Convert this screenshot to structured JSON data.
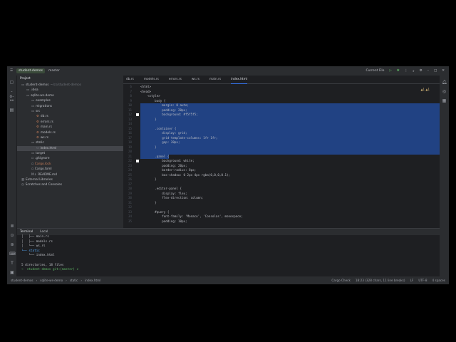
{
  "titlebar": {
    "project": "student-demos",
    "branch": "master",
    "run_config": "Current File"
  },
  "project_panel": {
    "title": "Project",
    "items": [
      {
        "label": "student-demos",
        "note": "~/cs/student-demos",
        "depth": 0,
        "icon": "folder"
      },
      {
        "label": ".idea",
        "depth": 1,
        "icon": "folder"
      },
      {
        "label": "sqlite-ws-demo",
        "depth": 1,
        "icon": "folder"
      },
      {
        "label": "examples",
        "depth": 2,
        "icon": "folder"
      },
      {
        "label": "migrations",
        "depth": 2,
        "icon": "folder"
      },
      {
        "label": "src",
        "depth": 2,
        "icon": "folder"
      },
      {
        "label": "db.rs",
        "depth": 3,
        "icon": "rust"
      },
      {
        "label": "errors.rs",
        "depth": 3,
        "icon": "rust"
      },
      {
        "label": "main.rs",
        "depth": 3,
        "icon": "rust"
      },
      {
        "label": "models.rs",
        "depth": 3,
        "icon": "rust"
      },
      {
        "label": "ws.rs",
        "depth": 3,
        "icon": "rust"
      },
      {
        "label": "static",
        "depth": 2,
        "icon": "folder"
      },
      {
        "label": "index.html",
        "depth": 3,
        "icon": "html"
      },
      {
        "label": "target",
        "depth": 2,
        "icon": "folder"
      },
      {
        "label": ".gitignore",
        "depth": 2,
        "icon": "file"
      },
      {
        "label": "Cargo.lock",
        "depth": 2,
        "icon": "file"
      },
      {
        "label": "Cargo.toml",
        "depth": 2,
        "icon": "file"
      },
      {
        "label": "README.md",
        "depth": 2,
        "icon": "md"
      },
      {
        "label": "External Libraries",
        "depth": 0,
        "icon": "lib"
      },
      {
        "label": "Scratches and Consoles",
        "depth": 0,
        "icon": "scratch"
      }
    ]
  },
  "tabs": [
    "db.rs",
    "models.rs",
    "errors.rs",
    "ws.rs",
    "main.rs",
    "index.html"
  ],
  "editor": {
    "inspection": "▲1 ▲1",
    "lines": [
      {
        "n": "6",
        "t": "<html>"
      },
      {
        "n": "7",
        "t": "<head>"
      },
      {
        "n": "8",
        "t": "    <style>"
      },
      {
        "n": "9",
        "t": "        body {"
      },
      {
        "n": "10",
        "t": "            margin: 0 auto;"
      },
      {
        "n": "11",
        "t": "            padding: 20px;"
      },
      {
        "n": "12",
        "t": "            background: #f5f5f5;"
      },
      {
        "n": "13",
        "t": "        }"
      },
      {
        "n": "14",
        "t": ""
      },
      {
        "n": "15",
        "t": "        .container {"
      },
      {
        "n": "16",
        "t": "            display: grid;"
      },
      {
        "n": "17",
        "t": "            grid-template-columns: 1fr 1fr;"
      },
      {
        "n": "18",
        "t": "            gap: 20px;"
      },
      {
        "n": "19",
        "t": "        }"
      },
      {
        "n": "20",
        "t": ""
      },
      {
        "n": "21",
        "t": "        .panel {"
      },
      {
        "n": "22",
        "t": "            background: white;"
      },
      {
        "n": "23",
        "t": "            padding: 20px;"
      },
      {
        "n": "24",
        "t": "            border-radius: 8px;"
      },
      {
        "n": "25",
        "t": "            box-shadow: 0 2px 4px rgba(0,0,0,0.1);"
      },
      {
        "n": "26",
        "t": "        }"
      },
      {
        "n": "27",
        "t": ""
      },
      {
        "n": "28",
        "t": "        .editor-panel {"
      },
      {
        "n": "29",
        "t": "            display: flex;"
      },
      {
        "n": "30",
        "t": "            flex-direction: column;"
      },
      {
        "n": "31",
        "t": "        }"
      },
      {
        "n": "32",
        "t": ""
      },
      {
        "n": "33",
        "t": "        #query {"
      },
      {
        "n": "34",
        "t": "            font-family: 'Monaco', 'Consolas', monospace;"
      },
      {
        "n": "35",
        "t": "            padding: 10px;"
      }
    ]
  },
  "terminal": {
    "tabs": [
      "Terminal",
      "Local"
    ],
    "lines": [
      "│   ├── main.rs",
      "│   ├── models.rs",
      "│   └── ws.rs",
      "└── static",
      "    └── index.html",
      "",
      "5 directories, 18 files",
      "→  student-demos git:(master) ✗ "
    ]
  },
  "status": {
    "breadcrumb": [
      "student-demos",
      "sqlite-ws-demo",
      "static",
      "index.html"
    ],
    "cargo": "Cargo Check",
    "position": "18:23 (328 chars, 11 line breaks)",
    "line_sep": "LF",
    "encoding": "UTF-8",
    "indent": "4 spaces"
  },
  "colors": {
    "selection": "#214283",
    "accent": "#3574f0"
  }
}
